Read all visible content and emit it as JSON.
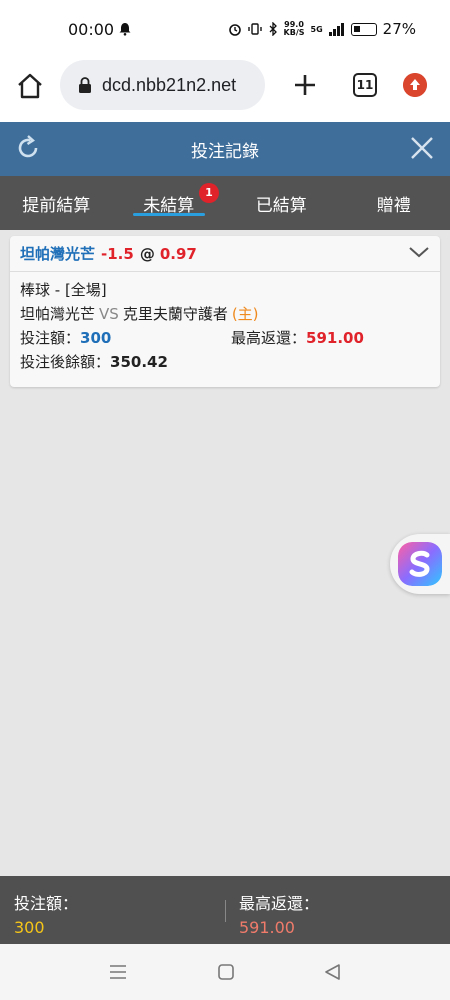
{
  "status_bar": {
    "time": "00:00",
    "net_speed_value": "99.0",
    "net_speed_unit": "KB/S",
    "network": "5G",
    "battery": "27%"
  },
  "browser": {
    "url": "dcd.nbb21n2.net",
    "tab_count": "11"
  },
  "header": {
    "title": "投注記錄"
  },
  "tabs": [
    {
      "label": "提前結算",
      "active": false
    },
    {
      "label": "未結算",
      "active": true,
      "badge": "1"
    },
    {
      "label": "已結算",
      "active": false
    },
    {
      "label": "贈禮",
      "active": false
    }
  ],
  "bet": {
    "selection": "坦帕灣光芒",
    "handicap": "-1.5",
    "at": "@",
    "odds": "0.97",
    "sport_period": "棒球 - [全場]",
    "team_a": "坦帕灣光芒",
    "vs": "VS",
    "team_b": "克里夫蘭守護者",
    "home_tag": "(主)",
    "stake_label": "投注額：",
    "stake_value": "300",
    "max_return_label": "最高返還：",
    "max_return_value": "591.00",
    "balance_label": "投注後餘額：",
    "balance_value": "350.42"
  },
  "footer": {
    "stake_label": "投注額：",
    "stake_value": "300",
    "return_label": "最高返還：",
    "return_value": "591.00"
  },
  "colors": {
    "header_bg": "#3f6e9b",
    "tabs_bg": "#535353",
    "accent_blue": "#1f6fb8",
    "accent_red": "#e0222b",
    "footer_bg": "#505050"
  }
}
